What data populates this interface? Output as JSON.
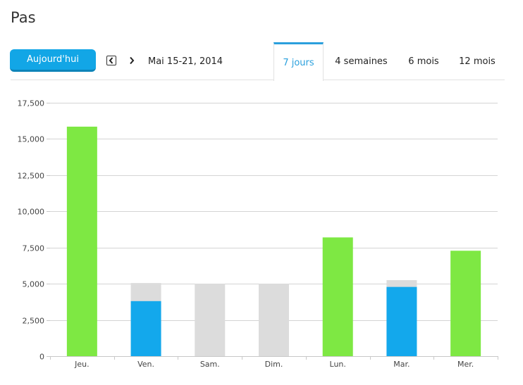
{
  "page": {
    "title": "Pas"
  },
  "toolbar": {
    "today_label": "Aujourd'hui",
    "prev_icon": "chevron-left-boxed-icon",
    "next_icon": "chevron-right-icon",
    "date_range": "Mai 15-21, 2014"
  },
  "tabs": [
    {
      "label": "7 jours",
      "active": true
    },
    {
      "label": "4 semaines",
      "active": false
    },
    {
      "label": "6 mois",
      "active": false
    },
    {
      "label": "12 mois",
      "active": false
    }
  ],
  "colors": {
    "goal_met": "#7ee843",
    "steps": "#13a8ec",
    "goal": "#dcdcdc",
    "accent": "#2ba0dd"
  },
  "chart_data": {
    "type": "bar",
    "categories": [
      "Jeu.",
      "Ven.",
      "Sam.",
      "Dim.",
      "Lun.",
      "Mar.",
      "Mer."
    ],
    "steps": [
      15850,
      3800,
      0,
      0,
      8200,
      4780,
      7280
    ],
    "goal": [
      5000,
      5050,
      5000,
      5000,
      5000,
      5250,
      5000
    ],
    "goal_met": [
      true,
      false,
      false,
      false,
      true,
      false,
      true
    ],
    "yticks": [
      "0",
      "2,500",
      "5,000",
      "7,500",
      "10,000",
      "12,500",
      "15,000",
      "17,500"
    ],
    "ylim": [
      0,
      17500
    ],
    "grid": true,
    "stacked_overlay": true
  }
}
